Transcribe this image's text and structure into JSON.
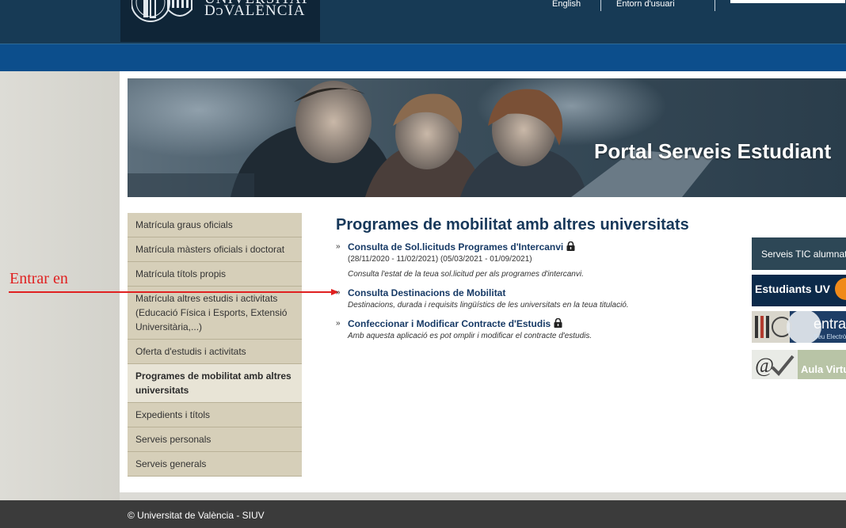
{
  "header": {
    "logo_line1": "UNIVERSITAT",
    "logo_line2": "DᴐVALÈNCIA",
    "links": [
      "English",
      "Entorn d'usuari"
    ]
  },
  "banner": {
    "title": "Portal Serveis Estudiant"
  },
  "sidebar": {
    "items": [
      {
        "label": "Matrícula graus oficials"
      },
      {
        "label": "Matrícula màsters oficials i doctorat"
      },
      {
        "label": "Matrícula títols propis"
      },
      {
        "label": "Matrícula altres estudis i activitats (Educació Física i Esports, Extensió Universitària,...)"
      },
      {
        "label": "Oferta d'estudis i activitats"
      },
      {
        "label": "Programes de mobilitat amb altres universitats"
      },
      {
        "label": "Expedients i títols"
      },
      {
        "label": "Serveis personals"
      },
      {
        "label": "Serveis generals"
      }
    ],
    "active_index": 5
  },
  "annotation": {
    "text": "Entrar en",
    "color": "#e02020"
  },
  "main": {
    "title": "Programes de mobilitat amb altres universitats",
    "entries": [
      {
        "link": "Consulta de Sol.licituds Programes d'Intercanvi",
        "locked": true,
        "dates": "(28/11/2020 - 11/02/2021) (05/03/2021 - 01/09/2021)",
        "description": "Consulta l'estat de la teua sol.licitud per als programes d'intercanvi."
      },
      {
        "link": "Consulta Destinacions de Mobilitat",
        "locked": false,
        "description": "Destinacions, durada i requisits lingüístics de les universitats en la teua titulació."
      },
      {
        "link": "Confeccionar i Modificar Contracte d'Estudis",
        "locked": true,
        "description": "Amb aquesta aplicació es pot omplir i modificar el contracte d'estudis."
      }
    ]
  },
  "right_links": {
    "tic": "Serveis TIC alumnat",
    "estudiants": "Estudiants UV",
    "entra": "entra",
    "seu": "Seu Electrònica",
    "aula": "Aula Virtual"
  },
  "footer": {
    "text": "© Universitat de València - SIUV"
  },
  "colors": {
    "topbar": "#173a55",
    "bluebar": "#0c4e8c",
    "nav_bg": "#d6cfb9",
    "title": "#17385a",
    "footer": "#3b3b3b"
  }
}
